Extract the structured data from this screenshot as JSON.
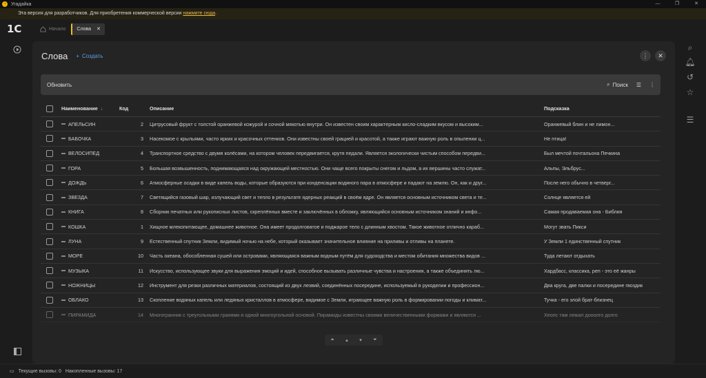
{
  "window": {
    "title": "Угадайка"
  },
  "notice": {
    "text": "Эта версия для разработчиков. Для приобретения коммерческой версии ",
    "link": "нажмите сюда",
    "end": "."
  },
  "topbar": {
    "logo": "1С",
    "home_label": "Начало",
    "tab_label": "Слова"
  },
  "panel": {
    "title": "Слова",
    "create_label": "Создать"
  },
  "toolbar": {
    "refresh_label": "Обновить",
    "search_label": "Поиск"
  },
  "table": {
    "columns": {
      "name": "Наименование",
      "code": "Код",
      "desc": "Описание",
      "hint": "Подсказка"
    },
    "rows": [
      {
        "name": "АПЕЛЬСИН",
        "code": "2",
        "desc": "Цитрусовый фрукт с толстой оранжевой кожурой и сочной мякотью внутри. Он известен своим характерным кисло-сладким вкусом и высоким...",
        "hint": "Оранжевый блин и не лимон..."
      },
      {
        "name": "БАБОЧКА",
        "code": "3",
        "desc": "Насекомое с крыльями, часто ярких и красочных оттенков. Они известны своей грацией и красотой, а также играют важную роль в опылении ц...",
        "hint": "Не птица!"
      },
      {
        "name": "ВЕЛОСИПЕД",
        "code": "4",
        "desc": "Транспортное средство с двумя колёсами, на котором человек передвигается, крутя педали. Является экологически чистым способом передви...",
        "hint": "Был мечтой почтальона Печкина"
      },
      {
        "name": "ГОРА",
        "code": "5",
        "desc": "Большая возвышенность, поднимающаяся над окружающей местностью. Они чаще всего покрыты снегом и льдом, а их вершины часто служат...",
        "hint": "Альпы, Эльбрус..."
      },
      {
        "name": "ДОЖДЬ",
        "code": "6",
        "desc": "Атмосферные осадки в виде капель воды, которые образуются при конденсации водяного пара в атмосфере и падают на землю. Он, как и друг...",
        "hint": "После него обычно в четверг..."
      },
      {
        "name": "ЗВЕЗДА",
        "code": "7",
        "desc": "Светящийся газовый шар, излучающий свет и тепло в результате ядерных реакций в своём ядре. Он является основным источником света и те...",
        "hint": "Солнце является ей"
      },
      {
        "name": "КНИГА",
        "code": "8",
        "desc": "Сборник печатных или рукописных листов, скреплённых вместе и заключённых в обложку, являющийся основным источником знаний и инфо...",
        "hint": "Самая продаваемая она - Библия"
      },
      {
        "name": "КОШКА",
        "code": "1",
        "desc": "Хищное млекопитающее, домашнее животное. Она имеет продолговатое и поджарое тело с длинным хвостом. Такое животное отлично караб...",
        "hint": "Могут звать Пикси"
      },
      {
        "name": "ЛУНА",
        "code": "9",
        "desc": "Естественный спутник Земли, видимый ночью на небе, который оказывает значительное влияние на приливы и отливы на планете.",
        "hint": "У Земли 1 единственный спутник"
      },
      {
        "name": "МОРЕ",
        "code": "10",
        "desc": "Часть океана, обособленная сушей или островами, являющаяся важным водным путём для судоходства и местом обитания множества видов ...",
        "hint": "Туда летают отдыхать"
      },
      {
        "name": "МУЗЫКА",
        "code": "11",
        "desc": "Искусство, использующее звуки для выражения эмоций и идей, способное вызывать различные чувства и настроения, а также объединять лю...",
        "hint": "Хардбасс, классика, реп - это её жанры"
      },
      {
        "name": "НОЖНИЦЫ",
        "code": "12",
        "desc": "Инструмент для резки различных материалов, состоящий из двух лезвий, соединённых посередине, используемый в рукоделии и профессион...",
        "hint": "Два круга, две палки и посередине гвоздик"
      },
      {
        "name": "ОБЛАКО",
        "code": "13",
        "desc": "Скопление водяных капель или ледяных кристаллов в атмосфере, видимое с Земли, играющее важную роль в формировании погоды и климат...",
        "hint": "Тучка - его злой брат-близнец"
      },
      {
        "name": "ПИРАМИДА",
        "code": "14",
        "desc": "Многогранник с треугольными гранями и одной многоугольной основой. Пирамиды известны своими величественными формами и являются ...",
        "hint": "Хеопс там лежал дооолго долго"
      }
    ]
  },
  "status": {
    "current_calls": "Текущие вызовы: 0",
    "accum_calls": "Накопленные вызовы: 17"
  },
  "colors": {
    "accent": "#5aa0e6",
    "tab_marker": "#f0c020",
    "notice_link": "#e8b84a"
  }
}
